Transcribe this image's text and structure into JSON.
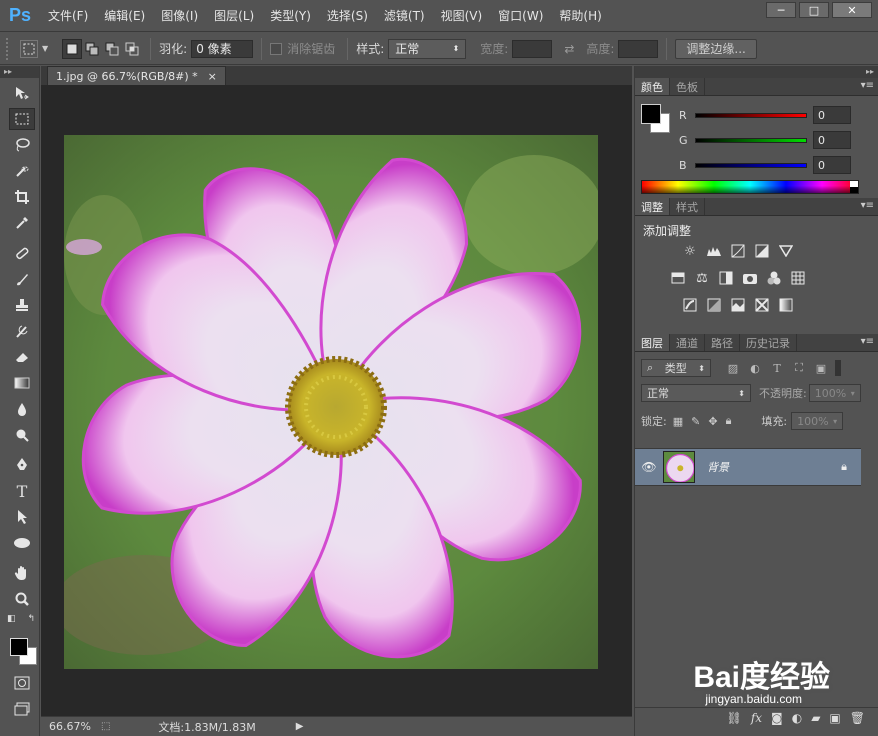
{
  "app": {
    "logo": "Ps"
  },
  "menu": [
    "文件(F)",
    "编辑(E)",
    "图像(I)",
    "图层(L)",
    "类型(Y)",
    "选择(S)",
    "滤镜(T)",
    "视图(V)",
    "窗口(W)",
    "帮助(H)"
  ],
  "window_buttons": {
    "minimize": "─",
    "maximize": "□",
    "close": "✕"
  },
  "options": {
    "feather_label": "羽化:",
    "feather_value": "0 像素",
    "antialias_label": "消除锯齿",
    "style_label": "样式:",
    "style_value": "正常",
    "width_label": "宽度:",
    "height_label": "高度:",
    "refine_edge": "调整边缘..."
  },
  "document": {
    "tab_title": "1.jpg @ 66.7%(RGB/8#) *",
    "tab_close": "×",
    "zoom": "66.67%",
    "doc_size": "文档:1.83M/1.83M"
  },
  "color_panel": {
    "tabs": [
      "颜色",
      "色板"
    ],
    "channels": [
      {
        "name": "R",
        "value": "0",
        "color": "#ff0000"
      },
      {
        "name": "G",
        "value": "0",
        "color": "#00cc00"
      },
      {
        "name": "B",
        "value": "0",
        "color": "#0000ff"
      }
    ]
  },
  "adjust_panel": {
    "tabs": [
      "调整",
      "样式"
    ],
    "title": "添加调整"
  },
  "layers_panel": {
    "tabs": [
      "图层",
      "通道",
      "路径",
      "历史记录"
    ],
    "filter_kind": "类型",
    "blend_mode": "正常",
    "opacity_label": "不透明度:",
    "opacity_value": "100%",
    "lock_label": "锁定:",
    "fill_label": "填充:",
    "fill_value": "100%",
    "layers": [
      {
        "name": "背景",
        "locked": true,
        "visible": true
      }
    ]
  },
  "watermark": {
    "brand": "Bai度经验",
    "url": "jingyan.baidu.com"
  }
}
